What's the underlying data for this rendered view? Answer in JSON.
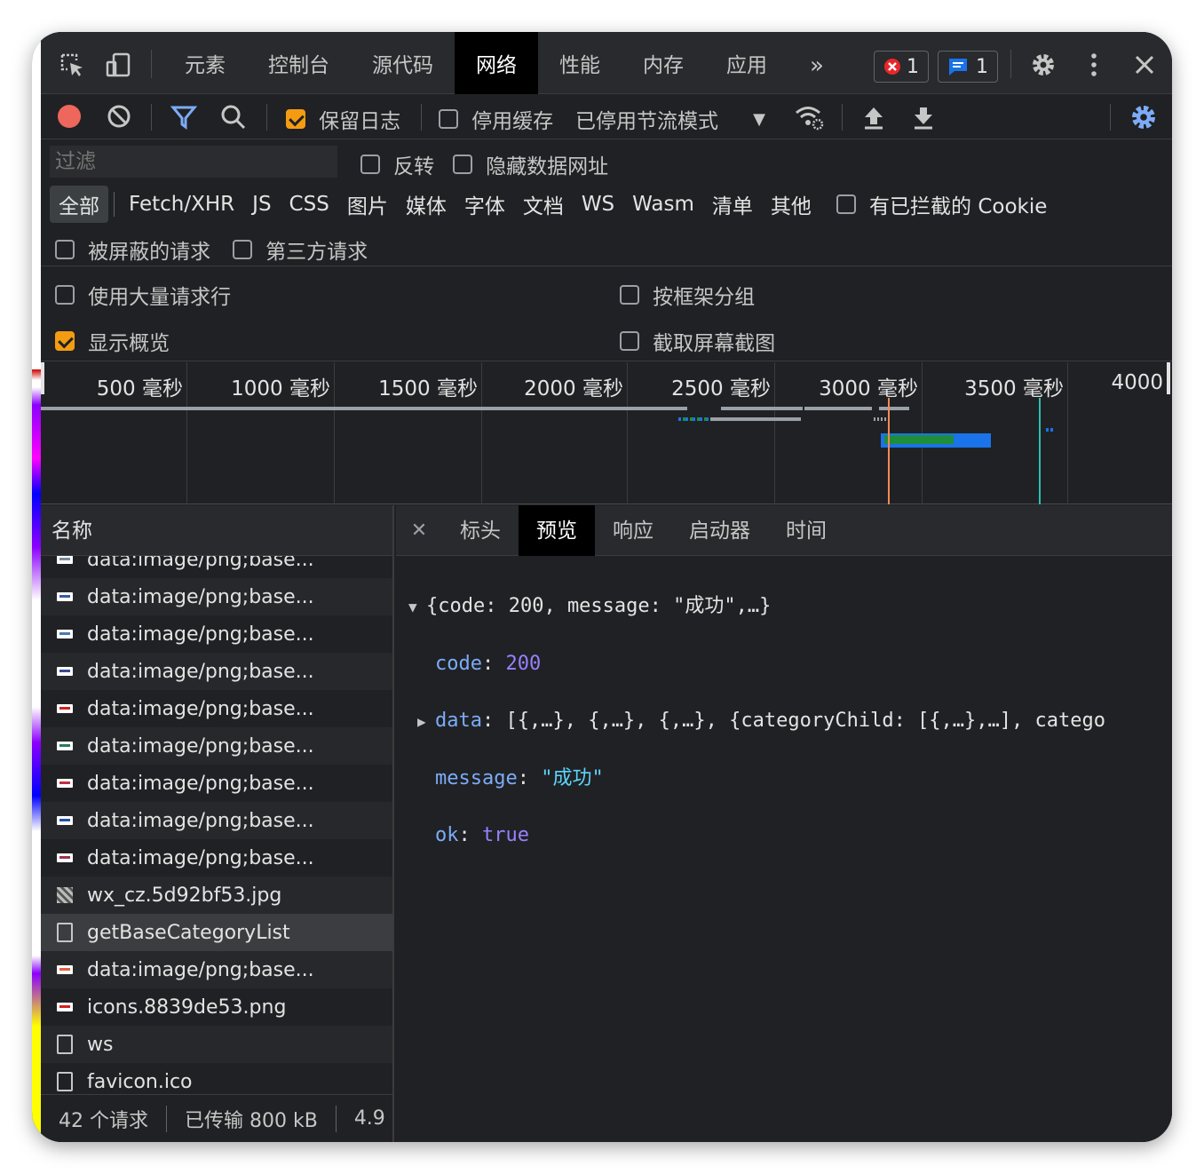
{
  "topbar": {
    "tabs": [
      "元素",
      "控制台",
      "源代码",
      "网络",
      "性能",
      "内存",
      "应用"
    ],
    "active_tab": "网络",
    "more_label": "»",
    "error_count": "1",
    "message_count": "1"
  },
  "toolbar": {
    "preserve_log_label": "保留日志",
    "preserve_log_checked": true,
    "disable_cache_label": "停用缓存",
    "throttle_value": "已停用节流模式"
  },
  "filter": {
    "placeholder": "过滤",
    "invert_label": "反转",
    "hide_data_urls_label": "隐藏数据网址",
    "types": [
      "全部",
      "Fetch/XHR",
      "JS",
      "CSS",
      "图片",
      "媒体",
      "字体",
      "文档",
      "WS",
      "Wasm",
      "清单",
      "其他"
    ],
    "blocked_cookies_label": "有已拦截的 Cookie",
    "blocked_requests_label": "被屏蔽的请求",
    "third_party_label": "第三方请求"
  },
  "options": {
    "big_rows_label": "使用大量请求行",
    "group_by_frame_label": "按框架分组",
    "show_overview_label": "显示概览",
    "capture_screenshots_label": "截取屏幕截图"
  },
  "timeline": {
    "ticks": [
      "500 毫秒",
      "1000 毫秒",
      "1500 毫秒",
      "2000 毫秒",
      "2500 毫秒",
      "3000 毫秒",
      "3500 毫秒",
      "4000"
    ]
  },
  "requests": {
    "header": "名称",
    "rows": [
      {
        "name": "data:image/png;base...",
        "type": "img",
        "color": "#7a8a9a"
      },
      {
        "name": "data:image/png;base...",
        "type": "img",
        "color": "#3a5aa0"
      },
      {
        "name": "data:image/png;base...",
        "type": "img",
        "color": "#4a7aaa"
      },
      {
        "name": "data:image/png;base...",
        "type": "img",
        "color": "#3a4a90"
      },
      {
        "name": "data:image/png;base...",
        "type": "img",
        "color": "#d02020"
      },
      {
        "name": "data:image/png;base...",
        "type": "img",
        "color": "#2a7a5a"
      },
      {
        "name": "data:image/png;base...",
        "type": "img",
        "color": "#c03040"
      },
      {
        "name": "data:image/png;base...",
        "type": "img",
        "color": "#2050b0"
      },
      {
        "name": "data:image/png;base...",
        "type": "img",
        "color": "#a03050"
      },
      {
        "name": "wx_cz.5d92bf53.jpg",
        "type": "qr",
        "color": "#888888"
      },
      {
        "name": "getBaseCategoryList",
        "type": "doc",
        "color": "#c4c7c5",
        "selected": true
      },
      {
        "name": "data:image/png;base...",
        "type": "img",
        "color": "#e06040"
      },
      {
        "name": "icons.8839de53.png",
        "type": "img",
        "color": "#d02020"
      },
      {
        "name": "ws",
        "type": "doc",
        "color": "#c4c7c5"
      },
      {
        "name": "favicon.ico",
        "type": "doc",
        "color": "#c4c7c5"
      }
    ],
    "status": {
      "count": "42 个请求",
      "transferred": "已传输 800 kB",
      "resources": "4.9"
    }
  },
  "detail": {
    "tabs": [
      "标头",
      "预览",
      "响应",
      "启动器",
      "时间"
    ],
    "active_tab": "预览",
    "preview": {
      "summary_open": "{code: 200, message: \"成功\",…}",
      "code_key": "code",
      "code_value": "200",
      "data_key": "data",
      "data_value": "[{,…}, {,…}, {,…}, {categoryChild: [{,…},…], catego",
      "message_key": "message",
      "message_value": "\"成功\"",
      "ok_key": "ok",
      "ok_value": "true"
    }
  },
  "colors": {
    "record": "#ee675c",
    "accent_blue": "#7cacf8",
    "checkbox_orange": "#f39c12",
    "error_red": "#e8262b",
    "message_blue": "#1a73e8"
  }
}
